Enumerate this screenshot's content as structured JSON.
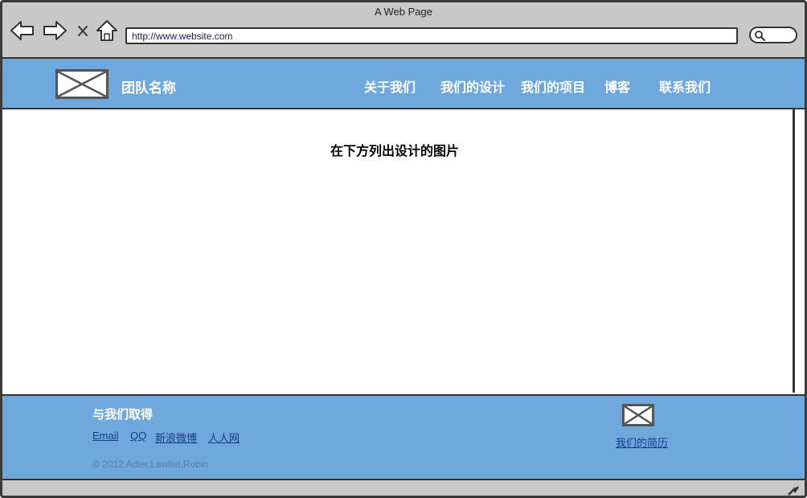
{
  "window": {
    "title": "A Web Page",
    "address": "http://www.website.com"
  },
  "icons": {
    "back": "arrow-left-icon",
    "forward": "arrow-right-icon",
    "stop": "close-icon",
    "home": "home-icon",
    "search": "search-icon",
    "logo": "image-placeholder-icon",
    "resume": "image-placeholder-icon",
    "resize": "resize-grip-icon"
  },
  "header": {
    "team_name": "团队名称",
    "nav": [
      "关于我们",
      "我们的设计",
      "我们的项目",
      "博客",
      "联系我们"
    ]
  },
  "main": {
    "heading": "在下方列出设计的图片"
  },
  "footer": {
    "heading": "与我们取得",
    "links": [
      "Email",
      "QQ",
      "新浪微博",
      "人人网"
    ],
    "copyright": "© 2012 Adler,Lawliet,Robin",
    "resume_link": "我们的简历"
  },
  "colors": {
    "header_bg": "#6fa8dc",
    "chrome_bg": "#c8c8c8",
    "link": "#1a3e8a"
  }
}
